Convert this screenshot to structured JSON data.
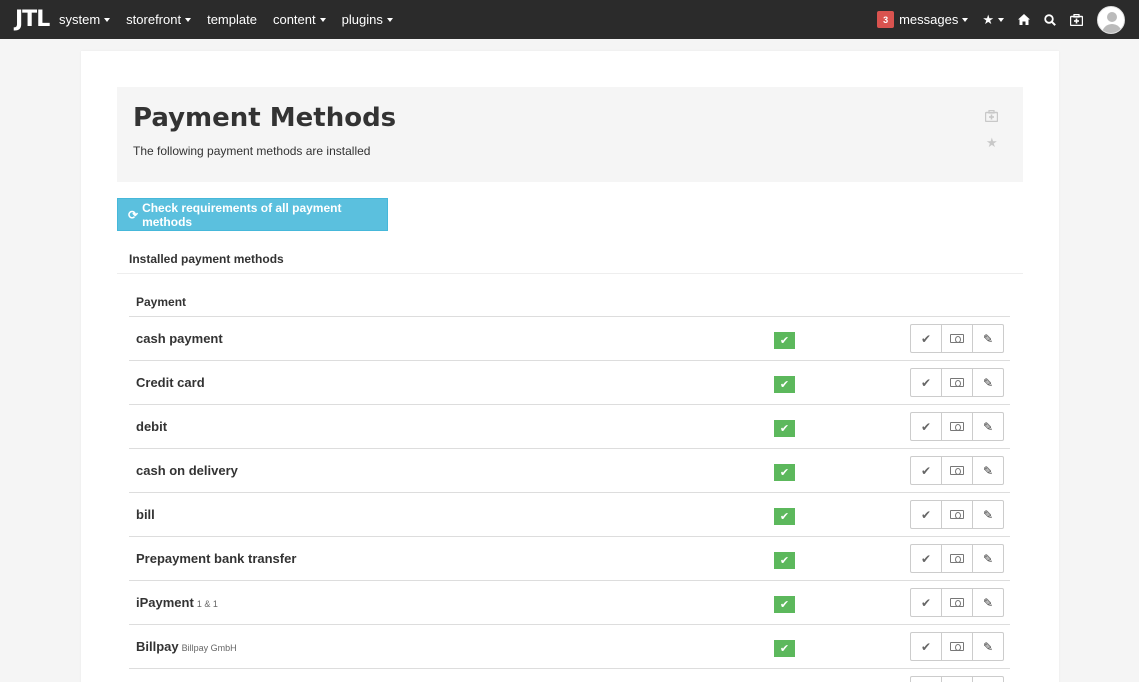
{
  "nav": {
    "logo": "JTL",
    "items": [
      {
        "label": "system",
        "has_caret": true
      },
      {
        "label": "storefront",
        "has_caret": true
      },
      {
        "label": "template",
        "has_caret": false
      },
      {
        "label": "content",
        "has_caret": true
      },
      {
        "label": "plugins",
        "has_caret": true
      }
    ],
    "messages_count": "3",
    "messages_label": "messages",
    "icons": [
      "star-icon",
      "home-icon",
      "search-icon",
      "medkit-icon",
      "avatar"
    ]
  },
  "header": {
    "title": "Payment Methods",
    "subtitle": "The following payment methods are installed"
  },
  "check_button": {
    "label": "Check requirements of all payment methods"
  },
  "section": {
    "title": "Installed payment methods"
  },
  "table": {
    "column_header": "Payment",
    "rows": [
      {
        "name": "cash payment",
        "vendor": ""
      },
      {
        "name": "Credit card",
        "vendor": ""
      },
      {
        "name": "debit",
        "vendor": ""
      },
      {
        "name": "cash on delivery",
        "vendor": ""
      },
      {
        "name": "bill",
        "vendor": ""
      },
      {
        "name": "Prepayment bank transfer",
        "vendor": ""
      },
      {
        "name": "iPayment",
        "vendor": "1 & 1"
      },
      {
        "name": "Billpay",
        "vendor": "Billpay GmbH"
      }
    ]
  },
  "colors": {
    "navbar": "#2b2b2b",
    "badge": "#d9534f",
    "info_button": "#5bc0de",
    "active_status": "#5cb85c"
  }
}
